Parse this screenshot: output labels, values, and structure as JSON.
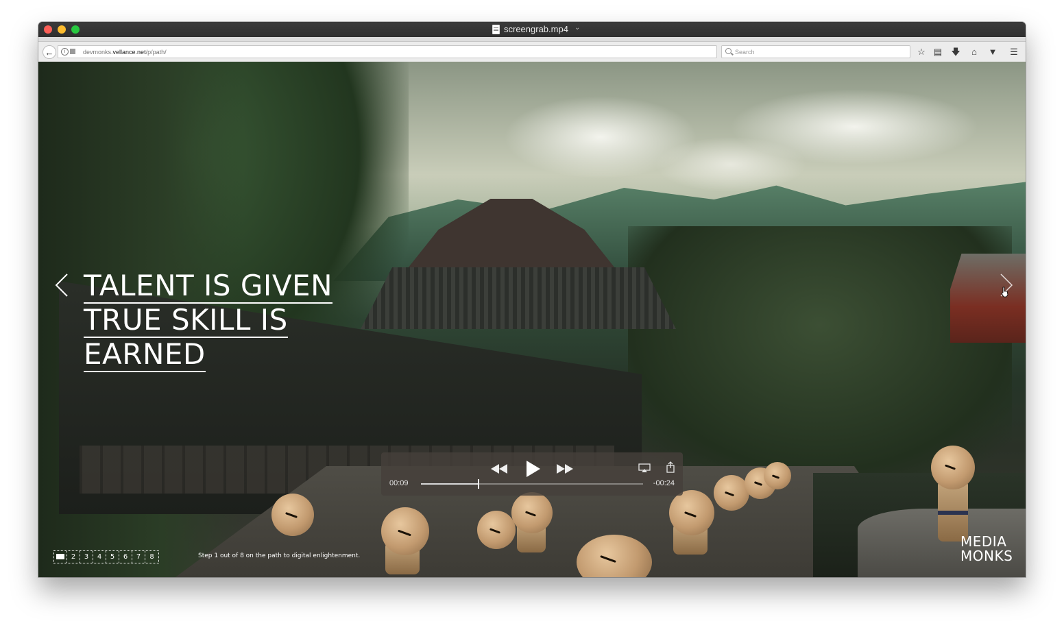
{
  "window": {
    "title": "screengrab.mp4"
  },
  "browser": {
    "url_prefix": "devmonks.",
    "url_domain": "vellance.net",
    "url_path": "/p/path/",
    "search_placeholder": "Search",
    "toolbar_icons": [
      "star-icon",
      "reading-list-icon",
      "download-icon",
      "home-icon",
      "pocket-icon",
      "menu-icon"
    ]
  },
  "hero": {
    "headline_lines": [
      "TALENT IS GIVEN",
      "TRUE SKILL IS",
      "EARNED"
    ]
  },
  "player": {
    "elapsed": "00:09",
    "remaining": "-00:24",
    "progress": 0.26
  },
  "steps": {
    "items": [
      "2",
      "3",
      "4",
      "5",
      "6",
      "7",
      "8"
    ],
    "caption": "Step 1 out of 8 on the path to digital enlightenment."
  },
  "brand": {
    "line1": "MEDIA",
    "line2": "MONKS"
  },
  "colors": {
    "close": "#fc5f57",
    "minimize": "#fdbc2e",
    "zoom": "#28c840"
  }
}
